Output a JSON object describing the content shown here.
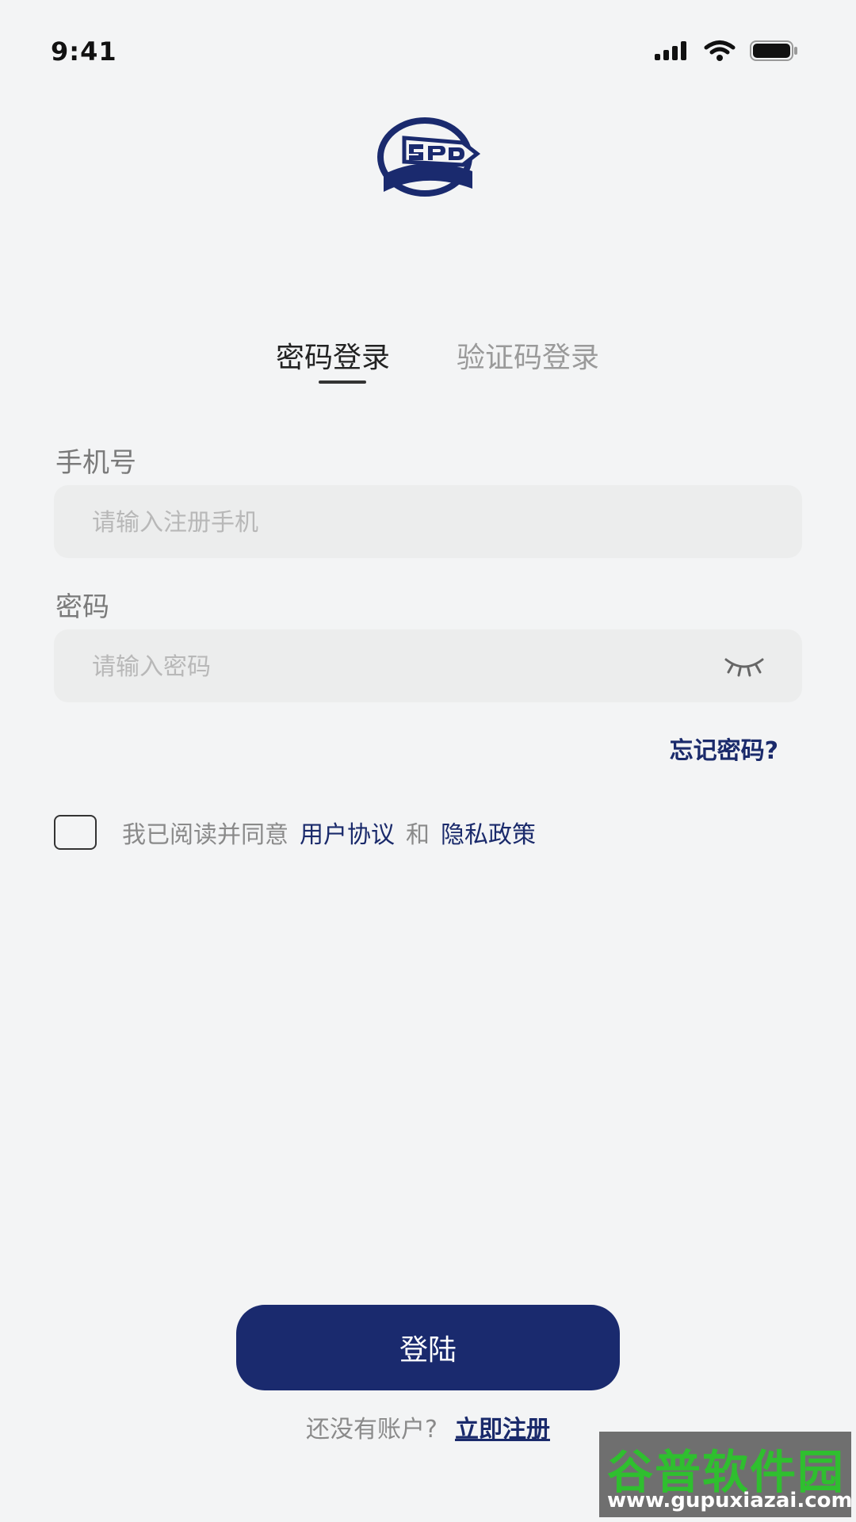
{
  "status_bar": {
    "time": "9:41"
  },
  "tabs": [
    {
      "label": "密码登录",
      "active": true
    },
    {
      "label": "验证码登录",
      "active": false
    }
  ],
  "phone": {
    "label": "手机号",
    "placeholder": "请输入注册手机"
  },
  "password": {
    "label": "密码",
    "placeholder": "请输入密码"
  },
  "forgot_label": "忘记密码?",
  "agreement": {
    "text": "我已阅读并同意",
    "user_agreement": "用户协议",
    "and": "和",
    "privacy_policy": "隐私政策"
  },
  "login_label": "登陆",
  "register": {
    "prompt": "还没有账户?",
    "link": "立即注册"
  },
  "watermark": {
    "title": "谷普软件园",
    "url": "www.gupuxiazai.com"
  },
  "colors": {
    "brand": "#1a2a6e",
    "background": "#f3f4f5",
    "watermark_green": "#2fbf2f"
  }
}
